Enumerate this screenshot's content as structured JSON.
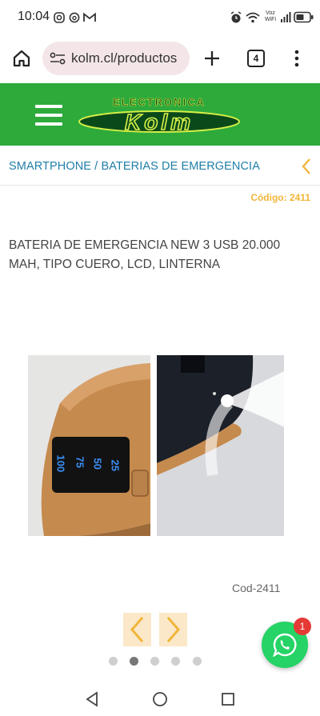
{
  "status_bar": {
    "time": "10:04",
    "volte_label": "Voz WiFi",
    "icons": [
      "instagram-icon",
      "threads-icon",
      "gmail-icon",
      "alarm-icon",
      "wifi-icon",
      "signal-icon",
      "battery-icon"
    ]
  },
  "browser": {
    "url": "kolm.cl/productos",
    "tab_count": "4",
    "icons": [
      "home-icon",
      "site-settings-icon",
      "new-tab-icon",
      "tabs-icon",
      "overflow-menu-icon"
    ]
  },
  "site_header": {
    "logo_top": "ELECTRONICA",
    "logo_main": "Kolm",
    "colors": {
      "header_green": "#2eaa3b",
      "logo_fill": "#0a4a1a",
      "logo_outline": "#d6ef47"
    }
  },
  "breadcrumb": {
    "text": "SMARTPHONE / BATERIAS DE EMERGENCIA",
    "color": "#1f7ea8"
  },
  "product": {
    "code_label": "Código: 2411",
    "title": "BATERIA DE EMERGENCIA NEW 3 USB 20.000 MAH, TIPO CUERO, LCD, LINTERNA",
    "caption": "Cod-2411",
    "lcd_digits": [
      "100",
      "75",
      "50",
      "25"
    ],
    "gallery_dots": 5,
    "active_dot": 2
  },
  "whatsapp": {
    "badge_count": "1",
    "icon": "whatsapp-icon"
  },
  "accent_colors": {
    "yellow": "#f1b53a",
    "arrow_bg": "#fbe8c8"
  }
}
